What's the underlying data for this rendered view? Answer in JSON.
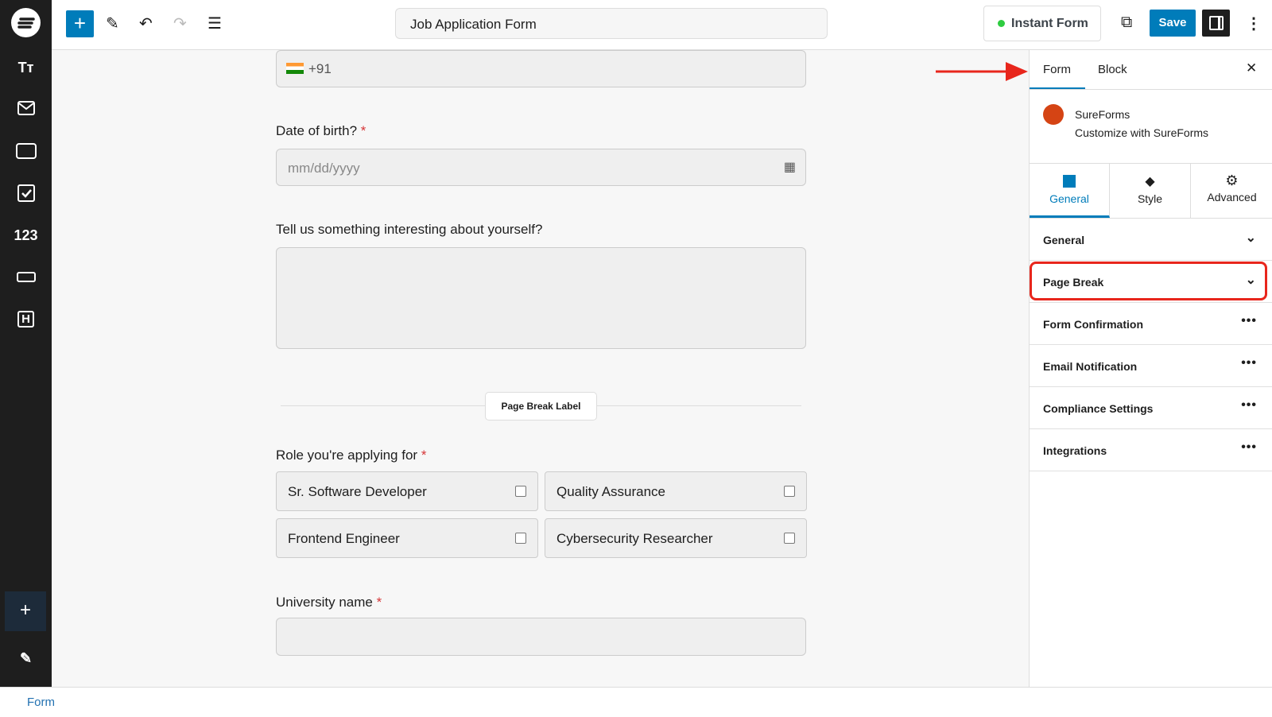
{
  "header": {
    "title": "Job Application Form",
    "instant_form": "Instant Form",
    "save": "Save"
  },
  "left_toolbar": {
    "items": [
      "logo-icon",
      "text-icon",
      "email-icon",
      "textarea-icon",
      "checkbox-icon",
      "number-icon",
      "dropdown-icon",
      "heading-icon"
    ],
    "number_label": "123",
    "heading_label": "H"
  },
  "form": {
    "phone_prefix": "+91",
    "dob_label": "Date of birth?",
    "dob_placeholder": "mm/dd/yyyy",
    "about_label": "Tell us something interesting about yourself?",
    "page_break_label": "Page Break Label",
    "role_label": "Role you're applying for",
    "roles": [
      "Sr. Software Developer",
      "Quality Assurance",
      "Frontend Engineer",
      "Cybersecurity Researcher"
    ],
    "university_label": "University name",
    "required_mark": "*"
  },
  "sidebar": {
    "tabs": [
      "Form",
      "Block"
    ],
    "plugin_name": "SureForms",
    "plugin_desc": "Customize with SureForms",
    "subtabs": [
      "General",
      "Style",
      "Advanced"
    ],
    "sections": [
      "General",
      "Page Break",
      "Form Confirmation",
      "Email Notification",
      "Compliance Settings",
      "Integrations"
    ]
  },
  "status_bar": {
    "breadcrumb": "Form"
  },
  "colors": {
    "accent": "#007cba",
    "highlight": "#e8261c",
    "brand": "#d54414"
  }
}
